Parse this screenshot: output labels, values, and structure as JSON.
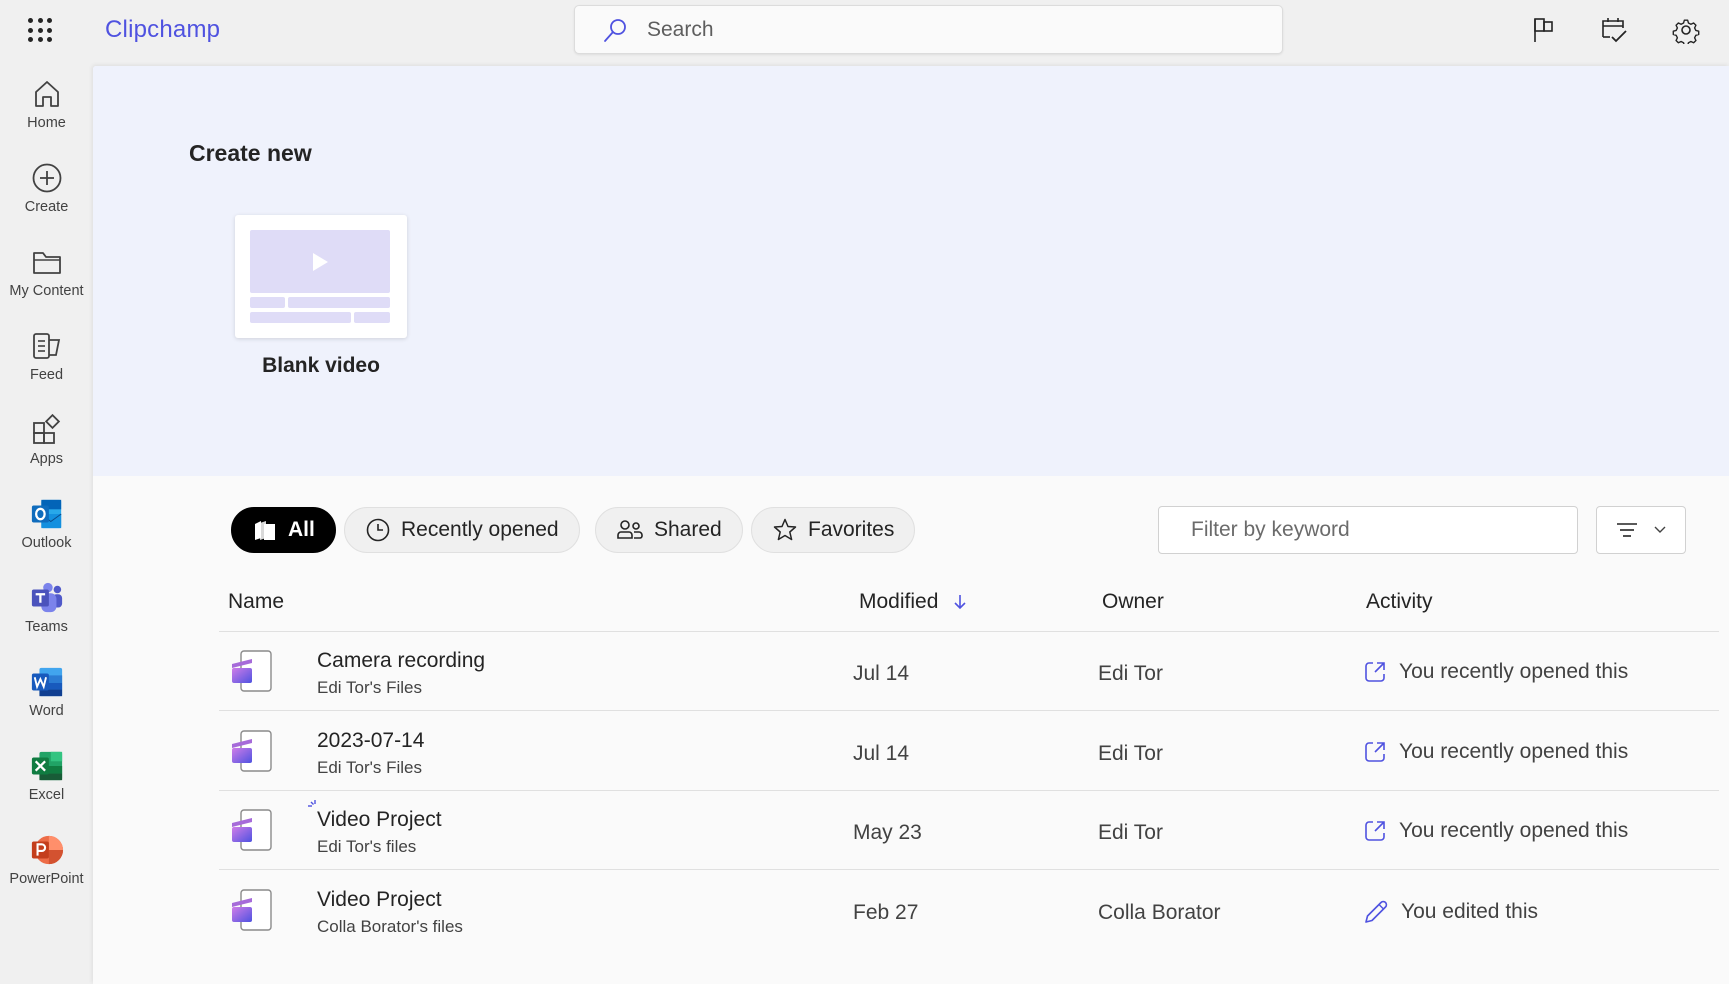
{
  "app": {
    "title": "Clipchamp",
    "accent": "#4f52e0"
  },
  "header": {
    "search_placeholder": "Search",
    "icons": [
      "flag-icon",
      "calendar-check-icon",
      "gear-icon"
    ]
  },
  "sidebar": {
    "items": [
      {
        "label": "Home",
        "icon": "home-icon"
      },
      {
        "label": "Create",
        "icon": "plus-circle-icon"
      },
      {
        "label": "My Content",
        "icon": "folder-icon"
      },
      {
        "label": "Feed",
        "icon": "feed-icon"
      },
      {
        "label": "Apps",
        "icon": "apps-icon"
      },
      {
        "label": "Outlook",
        "icon": "outlook-icon",
        "color": "#0a64c8"
      },
      {
        "label": "Teams",
        "icon": "teams-icon",
        "color": "#5059c9"
      },
      {
        "label": "Word",
        "icon": "word-icon",
        "color": "#185abd"
      },
      {
        "label": "Excel",
        "icon": "excel-icon",
        "color": "#107c41"
      },
      {
        "label": "PowerPoint",
        "icon": "powerpoint-icon",
        "color": "#c43e1c"
      }
    ]
  },
  "create_new": {
    "heading": "Create new",
    "tile_label": "Blank video"
  },
  "filters": {
    "pills": [
      {
        "label": "All",
        "icon": "library-icon",
        "active": true
      },
      {
        "label": "Recently opened",
        "icon": "clock-icon",
        "active": false
      },
      {
        "label": "Shared",
        "icon": "people-icon",
        "active": false
      },
      {
        "label": "Favorites",
        "icon": "star-icon",
        "active": false
      }
    ],
    "keyword_placeholder": "Filter by keyword",
    "sort_button_icon": "filter-sort-icon"
  },
  "table": {
    "columns": {
      "name": "Name",
      "modified": "Modified",
      "owner": "Owner",
      "activity": "Activity"
    },
    "sort": {
      "column": "Modified",
      "direction": "descending"
    },
    "rows": [
      {
        "name": "Camera recording",
        "location": "Edi Tor's Files",
        "modified": "Jul 14",
        "owner": "Edi Tor",
        "activity": "You recently opened this",
        "activity_icon": "open-external-icon"
      },
      {
        "name": "2023-07-14",
        "location": "Edi Tor's Files",
        "modified": "Jul 14",
        "owner": "Edi Tor",
        "activity": "You recently opened this",
        "activity_icon": "open-external-icon"
      },
      {
        "name": "Video Project",
        "location": "Edi Tor's files",
        "modified": "May 23",
        "owner": "Edi Tor",
        "activity": "You recently opened this",
        "activity_icon": "open-external-icon"
      },
      {
        "name": "Video Project",
        "location": "Colla Borator's files",
        "modified": "Feb 27",
        "owner": "Colla Borator",
        "activity": "You edited this",
        "activity_icon": "pencil-icon"
      }
    ]
  }
}
